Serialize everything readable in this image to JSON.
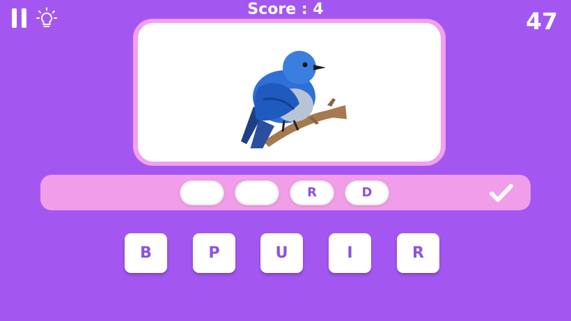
{
  "header": {
    "score_text": "Score : 4",
    "timer": "47",
    "pause_icon": "pause-icon",
    "hint_icon": "lightbulb-icon"
  },
  "picture": {
    "subject_icon": "bluebird-image"
  },
  "answer": {
    "slots": [
      "",
      "",
      "R",
      "D"
    ],
    "submit_icon": "checkmark-icon"
  },
  "letters": [
    "B",
    "P",
    "U",
    "I",
    "R"
  ],
  "colors": {
    "background": "#a457f0",
    "frame": "#f3a0ee",
    "answer_bar": "#f29de9",
    "letter_text": "#8b52e3"
  }
}
